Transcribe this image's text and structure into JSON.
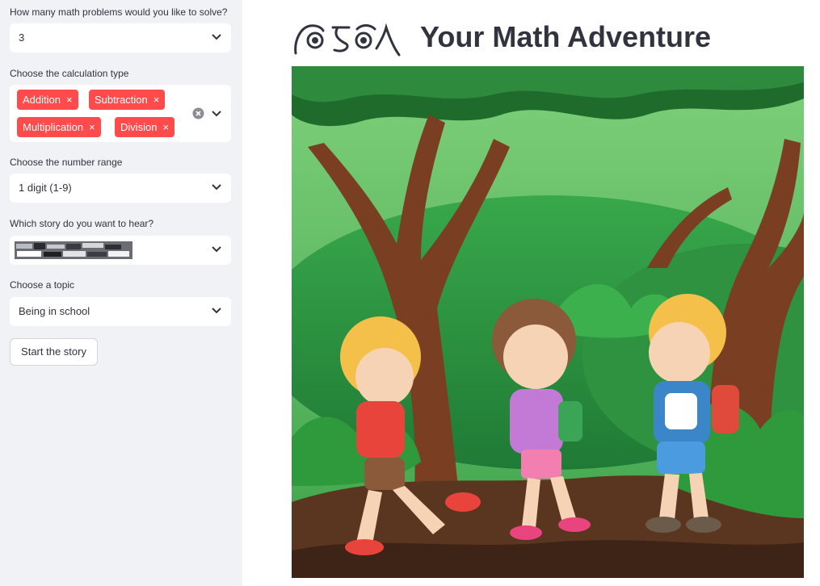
{
  "sidebar": {
    "problems": {
      "label": "How many math problems would you like to solve?",
      "value": "3"
    },
    "calc_type": {
      "label": "Choose the calculation type",
      "tags": [
        "Addition",
        "Subtraction",
        "Multiplication",
        "Division"
      ],
      "remove_glyph": "×"
    },
    "range": {
      "label": "Choose the number range",
      "value": "1 digit (1-9)"
    },
    "story": {
      "label": "Which story do you want to hear?",
      "value": ""
    },
    "topic": {
      "label": "Choose a topic",
      "value": "Being in school"
    },
    "start_label": "Start the story"
  },
  "main": {
    "title": "Your Math Adventure",
    "hero_image": "kids-hiking-forest-illustration",
    "icons": [
      "clear-all-icon",
      "chevron-down-icon",
      "title-emoji-icon"
    ]
  }
}
